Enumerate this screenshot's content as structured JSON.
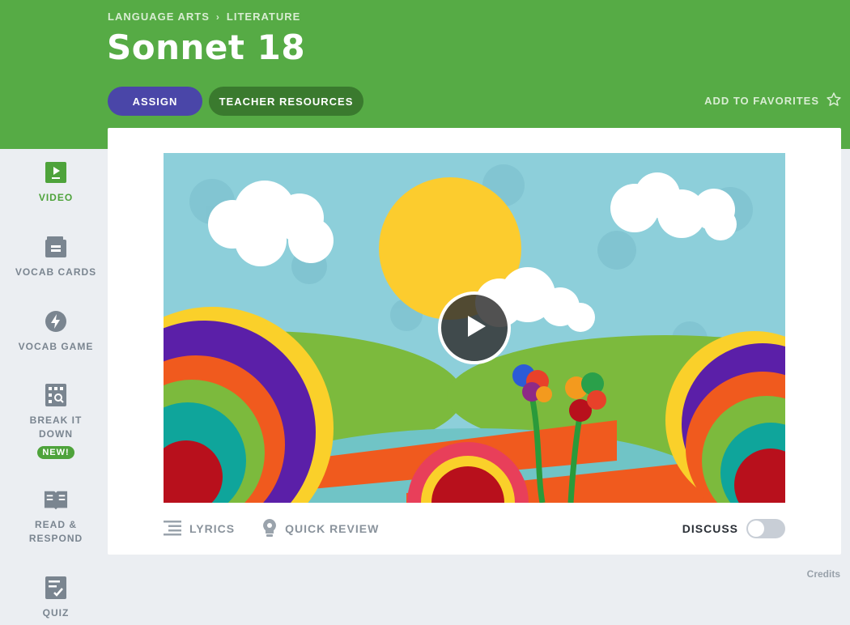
{
  "breadcrumb": {
    "subject": "LANGUAGE ARTS",
    "topic": "LITERATURE"
  },
  "page": {
    "title": "Sonnet 18"
  },
  "actions": {
    "assign": "ASSIGN",
    "teacher_resources": "TEACHER RESOURCES",
    "favorites": "ADD TO FAVORITES"
  },
  "sidebar": {
    "items": [
      {
        "label": "VIDEO",
        "active": true
      },
      {
        "label": "VOCAB CARDS"
      },
      {
        "label": "VOCAB GAME"
      },
      {
        "label": "BREAK IT DOWN",
        "badge": "NEW!"
      },
      {
        "label": "READ & RESPOND"
      },
      {
        "label": "QUIZ"
      }
    ]
  },
  "video_tools": {
    "lyrics": "LYRICS",
    "quick_review": "QUICK REVIEW",
    "discuss": "DISCUSS",
    "discuss_on": false
  },
  "footer": {
    "credits": "Credits"
  },
  "colors": {
    "header": "#56ab45",
    "assign": "#4a46a8",
    "teacher": "#3a7a2e",
    "active": "#4ea33b",
    "muted": "#7a8590"
  }
}
